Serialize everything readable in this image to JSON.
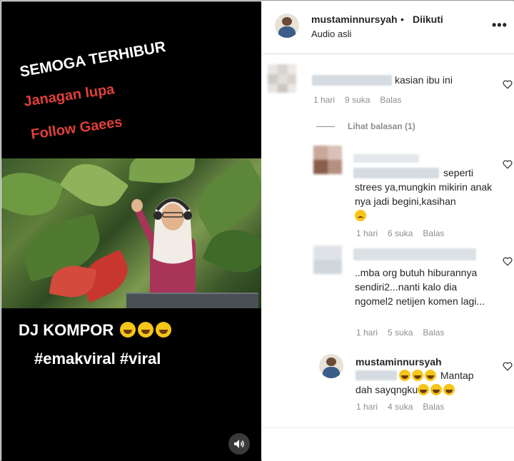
{
  "video": {
    "caption_line1": "SEMOGA TERHIBUR",
    "caption_line2": "Janagan lupa",
    "caption_line3": "Follow Gaees",
    "dj_text": "DJ KOMPOR",
    "hashtags": "#emakviral #viral",
    "sound_icon": "speaker-icon"
  },
  "header": {
    "username": "mustaminnursyah",
    "separator": "•",
    "follow_status": "Diikuti",
    "subtitle": "Audio asli",
    "more_icon": "•••"
  },
  "comments": [
    {
      "text": "kasian ibu ini",
      "time": "1 hari",
      "likes": "9 suka",
      "reply": "Balas"
    }
  ],
  "view_replies": "Lihat balasan (1)",
  "replies": [
    {
      "text_line1": "seperti",
      "text_rest": "strees ya,mungkin mikirin anak nya jadi begini,kasihan",
      "time": "1 hari",
      "likes": "6 suka",
      "reply": "Balas"
    },
    {
      "text": "..mba org butuh hiburannya sendiri2...nanti kalo dia ngomel2 netijen komen lagi...",
      "time": "1 hari",
      "likes": "5 suka",
      "reply": "Balas"
    },
    {
      "username": "mustaminnursyah",
      "text_after": "Mantap",
      "text_line2": "dah sayqngku",
      "time": "1 hari",
      "likes": "4 suka",
      "reply": "Balas"
    }
  ],
  "colors": {
    "accent_red": "#e0403a",
    "meta_gray": "#8e8e8e",
    "text_dark": "#262626"
  }
}
